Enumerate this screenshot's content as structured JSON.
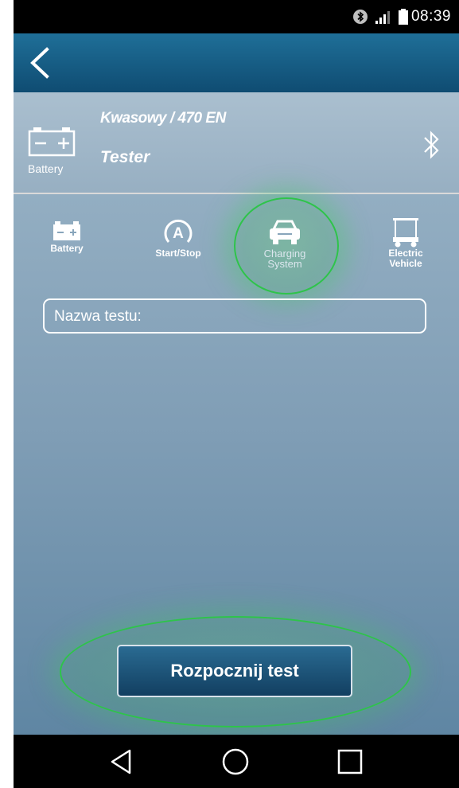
{
  "status_bar": {
    "time": "08:39",
    "icons": [
      "bluetooth-icon",
      "signal-icon",
      "battery-icon"
    ]
  },
  "header": {
    "back_icon": "chevron-left-icon"
  },
  "device": {
    "battery_label": "Battery",
    "profile": "Kwasowy / 470 EN",
    "name": "Tester",
    "connection_icon": "bluetooth-icon"
  },
  "modes": [
    {
      "label": "Battery",
      "icon": "battery-icon",
      "active": false
    },
    {
      "label": "Start/Stop",
      "icon": "start-stop-icon",
      "active": false
    },
    {
      "label_line1": "Charging",
      "label_line2": "System",
      "icon": "car-icon",
      "active": true
    },
    {
      "label_line1": "Electric",
      "label_line2": "Vehicle",
      "icon": "golf-cart-icon",
      "active": false
    }
  ],
  "test_name": {
    "label": "Nazwa testu:",
    "value": ""
  },
  "start_button": {
    "label": "Rozpocznij test"
  },
  "nav": {
    "icons": [
      "back-triangle-icon",
      "home-circle-icon",
      "recents-square-icon"
    ]
  },
  "colors": {
    "header": "#13527a",
    "highlight": "#2ec44a",
    "button": "#1c5478"
  }
}
